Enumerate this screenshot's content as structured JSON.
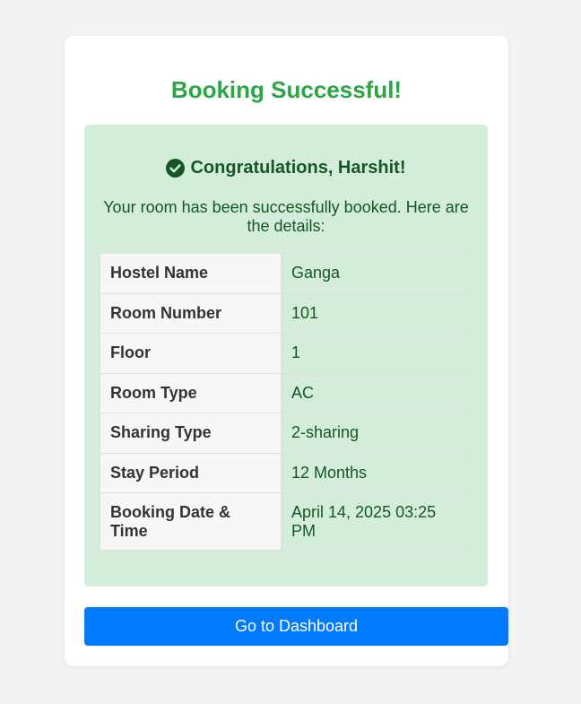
{
  "page": {
    "title": "Booking Successful!",
    "colors": {
      "title": "#28a745",
      "success_bg": "#d4edda",
      "success_text": "#155724",
      "button": "#007bff"
    }
  },
  "confirmation": {
    "icon": "check-circle-icon",
    "heading": "Congratulations, Harshit!",
    "message": "Your room has been successfully booked. Here are the details:"
  },
  "details": [
    {
      "label": "Hostel Name",
      "value": "Ganga"
    },
    {
      "label": "Room Number",
      "value": "101"
    },
    {
      "label": "Floor",
      "value": "1"
    },
    {
      "label": "Room Type",
      "value": "AC"
    },
    {
      "label": "Sharing Type",
      "value": "2-sharing"
    },
    {
      "label": "Stay Period",
      "value": "12 Months"
    },
    {
      "label": "Booking Date & Time",
      "value": "April 14, 2025 03:25 PM"
    }
  ],
  "actions": {
    "dashboard_label": "Go to Dashboard"
  }
}
